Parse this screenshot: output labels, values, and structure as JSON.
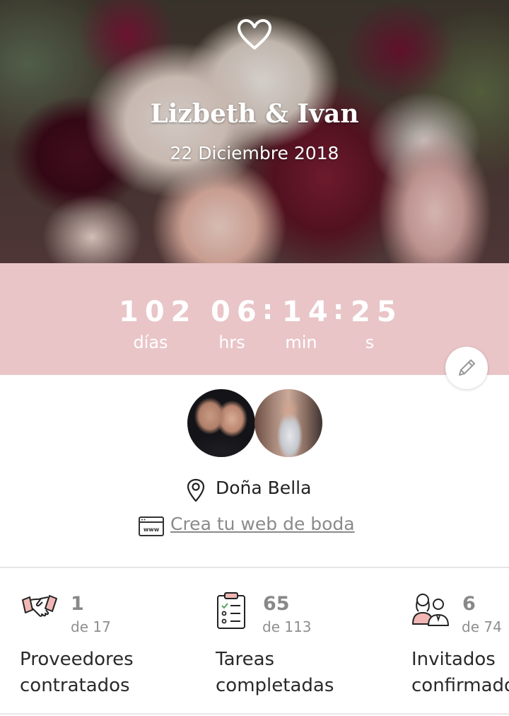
{
  "header": {
    "couple_names": "Lizbeth & Ivan",
    "date": "22 Diciembre 2018"
  },
  "countdown": {
    "days": "102",
    "hours": "06",
    "minutes": "14",
    "seconds": "25",
    "separator": ":",
    "days_label": "días",
    "hours_label": "hrs",
    "minutes_label": "min",
    "seconds_label": "s"
  },
  "profile": {
    "venue": "Doña Bella",
    "web_link": "Crea tu web de boda"
  },
  "stats": [
    {
      "icon": "handshake-icon",
      "count": "1",
      "total": "de 17",
      "label_line1": "Proveedores",
      "label_line2": "contratados"
    },
    {
      "icon": "checklist-icon",
      "count": "65",
      "total": "de 113",
      "label_line1": "Tareas",
      "label_line2": "completadas"
    },
    {
      "icon": "guests-icon",
      "count": "6",
      "total": "de 74",
      "label_line1": "Invitados",
      "label_line2": "confirmados"
    }
  ],
  "colors": {
    "countdown_band": "#e9c5c8",
    "accent_pink": "#e8a9a9",
    "text_dark": "#222222",
    "text_muted": "#888888"
  }
}
